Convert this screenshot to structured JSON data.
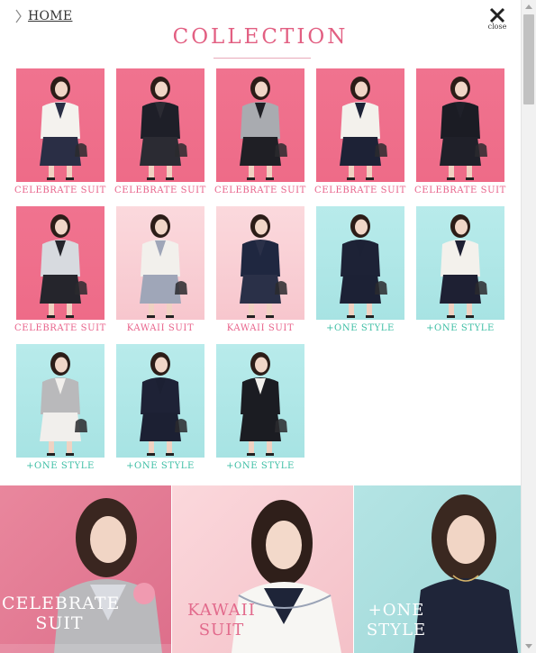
{
  "header": {
    "home_label": "HOME",
    "close_label": "close",
    "title": "COLLECTION"
  },
  "items": [
    {
      "caption": "CELEBRATE SUIT",
      "theme": "pink",
      "jacket": "#f4f2ee",
      "skirt": "#2a2e45"
    },
    {
      "caption": "CELEBRATE SUIT",
      "theme": "pink",
      "jacket": "#1e1f28",
      "skirt": "#2b2b33"
    },
    {
      "caption": "CELEBRATE SUIT",
      "theme": "pink",
      "jacket": "#a9abb0",
      "skirt": "#1f1f25"
    },
    {
      "caption": "CELEBRATE SUIT",
      "theme": "pink",
      "jacket": "#f3f1ec",
      "skirt": "#1d2236"
    },
    {
      "caption": "CELEBRATE SUIT",
      "theme": "pink",
      "jacket": "#1b1c24",
      "skirt": "#1f2029"
    },
    {
      "caption": "CELEBRATE SUIT",
      "theme": "pink",
      "jacket": "#d7dadf",
      "skirt": "#25252c"
    },
    {
      "caption": "KAWAII SUIT",
      "theme": "lpink",
      "jacket": "#f2f0ec",
      "skirt": "#9fa6b8"
    },
    {
      "caption": "KAWAII SUIT",
      "theme": "lpink",
      "jacket": "#1f2740",
      "skirt": "#2a3048"
    },
    {
      "caption": "+ONE STYLE",
      "theme": "aqua",
      "jacket": "#1d2236",
      "skirt": "#1c2135"
    },
    {
      "caption": "+ONE STYLE",
      "theme": "aqua",
      "jacket": "#f3f1ec",
      "skirt": "#1e2033"
    },
    {
      "caption": "+ONE STYLE",
      "theme": "aqua",
      "jacket": "#b9b9bb",
      "skirt": "#f1efec"
    },
    {
      "caption": "+ONE STYLE",
      "theme": "aqua",
      "jacket": "#1e2236",
      "skirt": "#1c2033"
    },
    {
      "caption": "+ONE STYLE",
      "theme": "aqua",
      "jacket": "#1b1c22",
      "skirt": "#1b1c22"
    }
  ],
  "banners": [
    {
      "line1": "CELEBRATE",
      "line2": "SUIT"
    },
    {
      "line1": "KAWAII",
      "line2": "SUIT"
    },
    {
      "line1": "+ONE",
      "line2": "STYLE"
    }
  ],
  "colors": {
    "pink_accent": "#e25f82",
    "teal_accent": "#3cbea4",
    "pink_bg": "#ee6b88",
    "light_pink_bg": "#f7c6cd",
    "aqua_bg": "#a7e3e3"
  }
}
